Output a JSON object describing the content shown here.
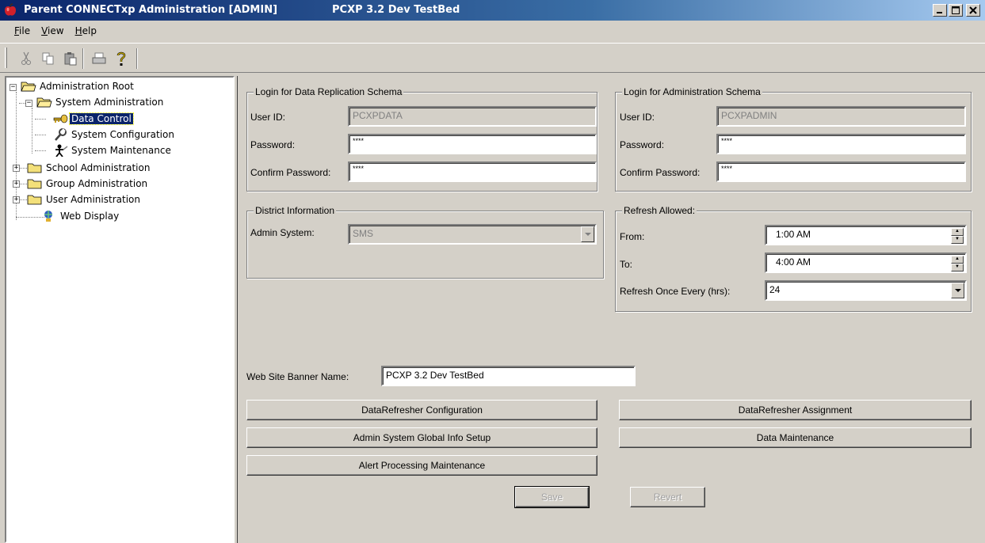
{
  "window": {
    "title": "Parent CONNECTxp Administration [ADMIN]",
    "subtitle": "PCXP 3.2 Dev TestBed"
  },
  "menu": [
    {
      "letter": "F",
      "rest": "ile"
    },
    {
      "letter": "V",
      "rest": "iew"
    },
    {
      "letter": "H",
      "rest": "elp"
    }
  ],
  "toolbar": [
    "cut-icon",
    "copy-icon",
    "paste-icon",
    "print-icon",
    "help-icon"
  ],
  "tree": {
    "root": "Administration Root",
    "system_admin": "System Administration",
    "data_control": "Data Control",
    "system_config": "System Configuration",
    "system_maint": "System Maintenance",
    "school_admin": "School Administration",
    "group_admin": "Group Administration",
    "user_admin": "User Administration",
    "web_display": "Web Display"
  },
  "replication": {
    "legend": "Login for Data Replication Schema",
    "user_label": "User ID:",
    "user_value": "PCXPDATA",
    "pwd_label": "Password:",
    "pwd_value": "****",
    "confirm_label": "Confirm Password:",
    "confirm_value": "****"
  },
  "admin_schema": {
    "legend": "Login for Administration Schema",
    "user_label": "User ID:",
    "user_value": "PCXPADMIN",
    "pwd_label": "Password:",
    "pwd_value": "****",
    "confirm_label": "Confirm Password:",
    "confirm_value": "****"
  },
  "district": {
    "legend": "District Information",
    "system_label": "Admin System:",
    "system_value": "SMS"
  },
  "refresh": {
    "legend": "Refresh Allowed:",
    "from_label": "From:",
    "from_value": "1:00 AM",
    "to_label": "To:",
    "to_value": "4:00 AM",
    "every_label": "Refresh Once Every (hrs):",
    "every_value": "24"
  },
  "banner": {
    "label": "Web Site Banner Name:",
    "value": "PCXP 3.2 Dev TestBed"
  },
  "buttons": {
    "refresher_config": "DataRefresher Configuration",
    "refresher_assign": "DataRefresher Assignment",
    "global_info": "Admin System Global Info Setup",
    "data_maint": "Data Maintenance",
    "alert_maint": "Alert Processing Maintenance",
    "save": "Save",
    "revert": "Revert"
  }
}
